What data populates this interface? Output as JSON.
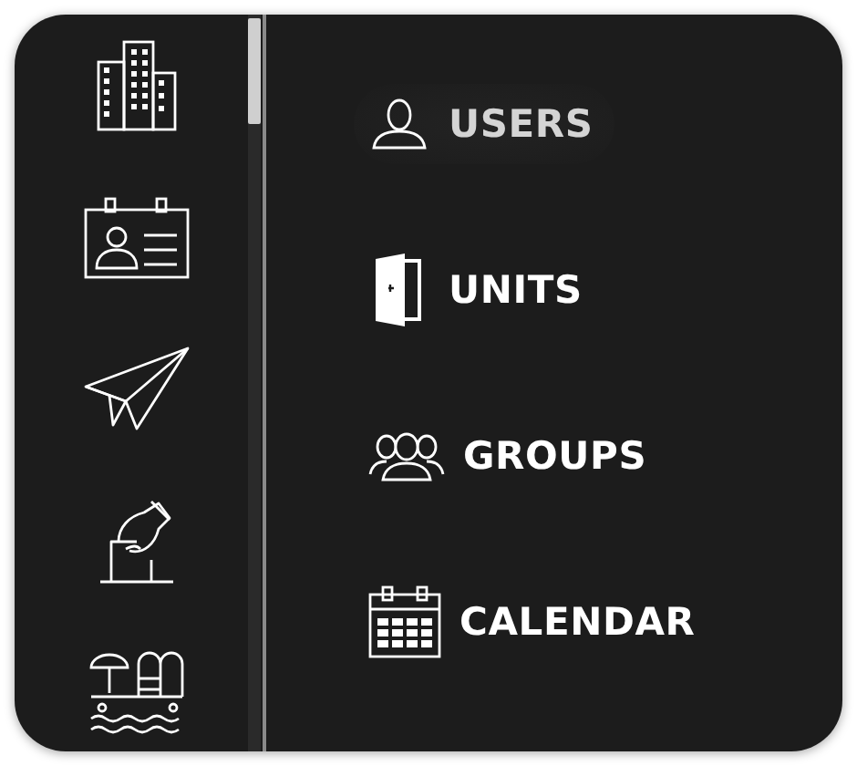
{
  "menu": [
    {
      "label": "USERS",
      "selected": true
    },
    {
      "label": "UNITS",
      "selected": false
    },
    {
      "label": "GROUPS",
      "selected": false
    },
    {
      "label": "CALENDAR",
      "selected": false
    }
  ]
}
